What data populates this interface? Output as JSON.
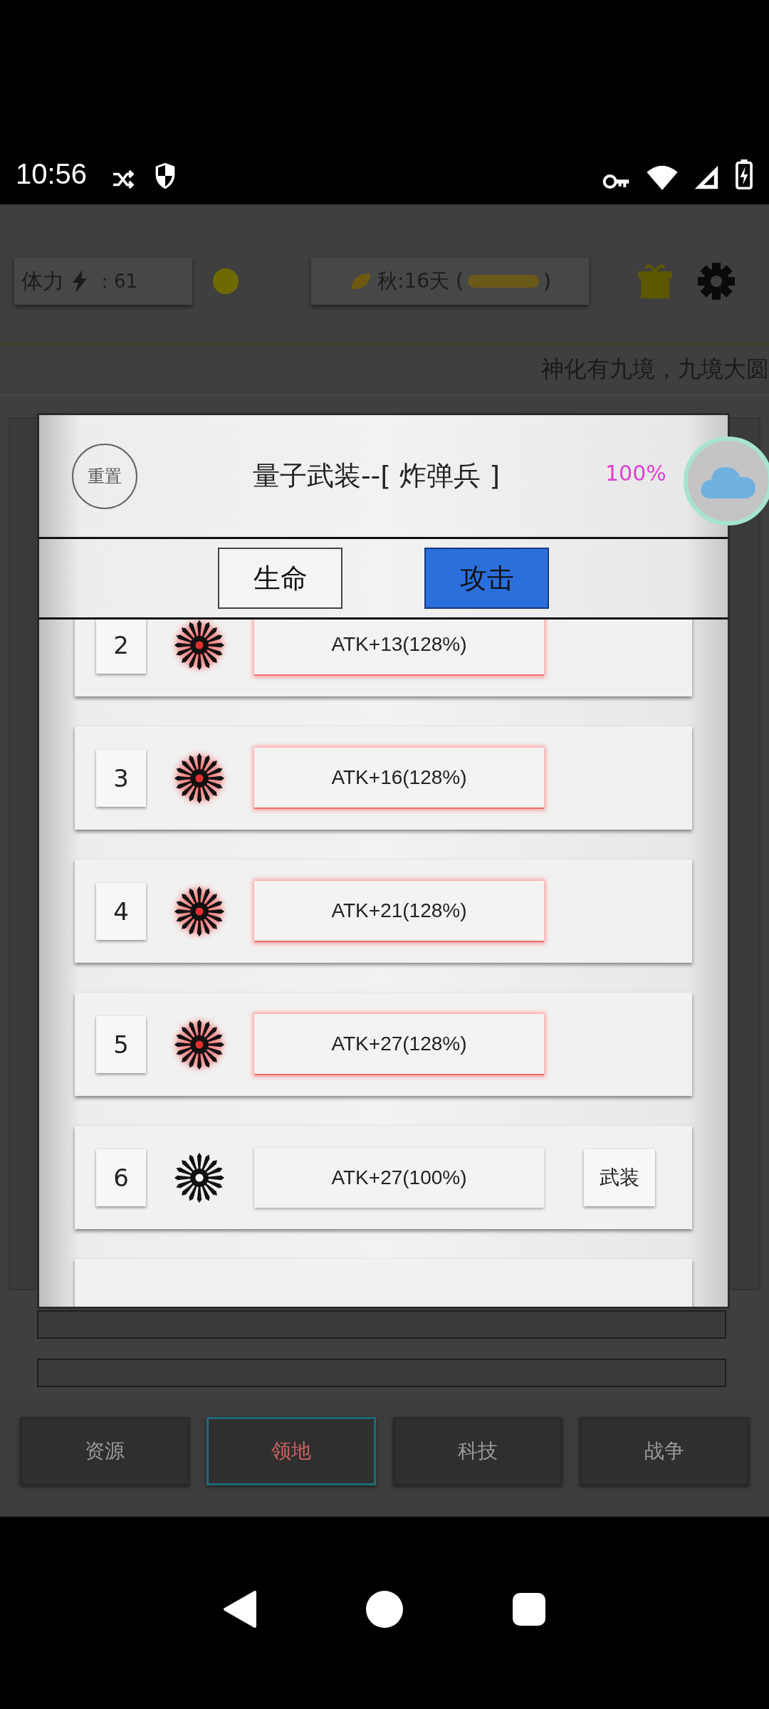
{
  "status_bar": {
    "time": "10:56"
  },
  "top_bar": {
    "stamina_label": "体力",
    "stamina_value": "：61",
    "season": "秋:16天 (",
    "season_close": ")"
  },
  "marquee": "神化有九境，九境大圆",
  "dialog": {
    "reset_button": "重置",
    "title": "量子武装--[ 炸弹兵 ]",
    "progress": "100%",
    "tabs": [
      {
        "label": "生命",
        "selected": false
      },
      {
        "label": "攻击",
        "selected": true
      }
    ],
    "rows": [
      {
        "index": "2",
        "stat": "ATK+13(128%)",
        "boosted": true
      },
      {
        "index": "3",
        "stat": "ATK+16(128%)",
        "boosted": true
      },
      {
        "index": "4",
        "stat": "ATK+21(128%)",
        "boosted": true
      },
      {
        "index": "5",
        "stat": "ATK+27(128%)",
        "boosted": true
      },
      {
        "index": "6",
        "stat": "ATK+27(100%)",
        "boosted": false,
        "action": "武装"
      }
    ]
  },
  "bottom_nav": [
    {
      "label": "资源",
      "selected": false
    },
    {
      "label": "领地",
      "selected": true
    },
    {
      "label": "科技",
      "selected": false
    },
    {
      "label": "战争",
      "selected": false
    }
  ]
}
